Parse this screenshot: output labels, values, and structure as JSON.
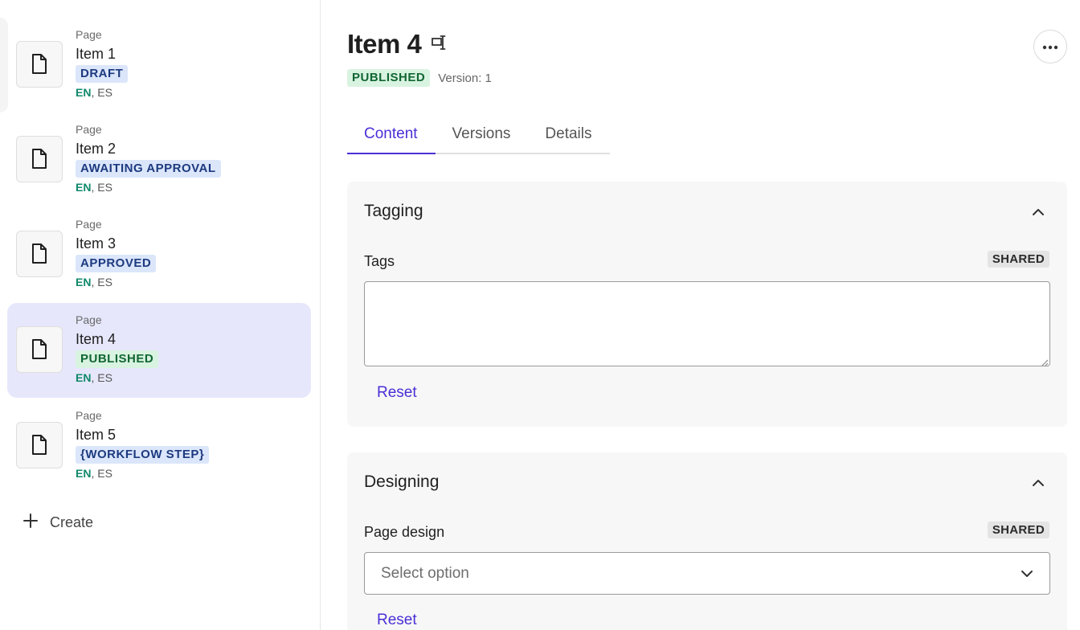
{
  "sidebar": {
    "items": [
      {
        "kind": "Page",
        "name": "Item 1",
        "status": "DRAFT",
        "status_color": "#1d3a7f",
        "langs": {
          "active": "EN",
          "sep": ",",
          "other": "ES"
        }
      },
      {
        "kind": "Page",
        "name": "Item 2",
        "status": "AWAITING APPROVAL",
        "status_color": "#1d3a7f",
        "langs": {
          "active": "EN",
          "sep": ",",
          "other": "ES"
        }
      },
      {
        "kind": "Page",
        "name": "Item 3",
        "status": "APPROVED",
        "status_color": "#1d3a7f",
        "langs": {
          "active": "EN",
          "sep": ",",
          "other": "ES"
        }
      },
      {
        "kind": "Page",
        "name": "Item 4",
        "status": "PUBLISHED",
        "status_color": "#116632",
        "langs": {
          "active": "EN",
          "sep": ",",
          "other": "ES"
        }
      },
      {
        "kind": "Page",
        "name": "Item 5",
        "status": "{WORKFLOW STEP}",
        "status_color": "#1d3a7f",
        "langs": {
          "active": "EN",
          "sep": ",",
          "other": "ES"
        }
      }
    ],
    "selected_index": 3,
    "create_label": "Create"
  },
  "header": {
    "title": "Item 4",
    "status": "PUBLISHED",
    "version": "Version: 1"
  },
  "tabs": [
    {
      "label": "Content",
      "active": true
    },
    {
      "label": "Versions",
      "active": false
    },
    {
      "label": "Details",
      "active": false
    }
  ],
  "panels": {
    "tagging": {
      "title": "Tagging",
      "field_label": "Tags",
      "shared_badge": "SHARED",
      "value": "",
      "reset_label": "Reset"
    },
    "designing": {
      "title": "Designing",
      "field_label": "Page design",
      "shared_badge": "SHARED",
      "select_placeholder": "Select option",
      "reset_label": "Reset"
    }
  },
  "colors": {
    "accent": "#4a2fd6",
    "selected_bg": "#e6e7fb",
    "published_bg": "#d9f3e1",
    "workflow_bg": "#dbe6fb",
    "lang_active": "#11896b"
  },
  "icons": {
    "item": "page-icon",
    "rename": "rename-icon",
    "more": "more-options-icon",
    "collapse": "chevron-up-icon",
    "select": "chevron-down-icon",
    "create": "plus-icon"
  }
}
